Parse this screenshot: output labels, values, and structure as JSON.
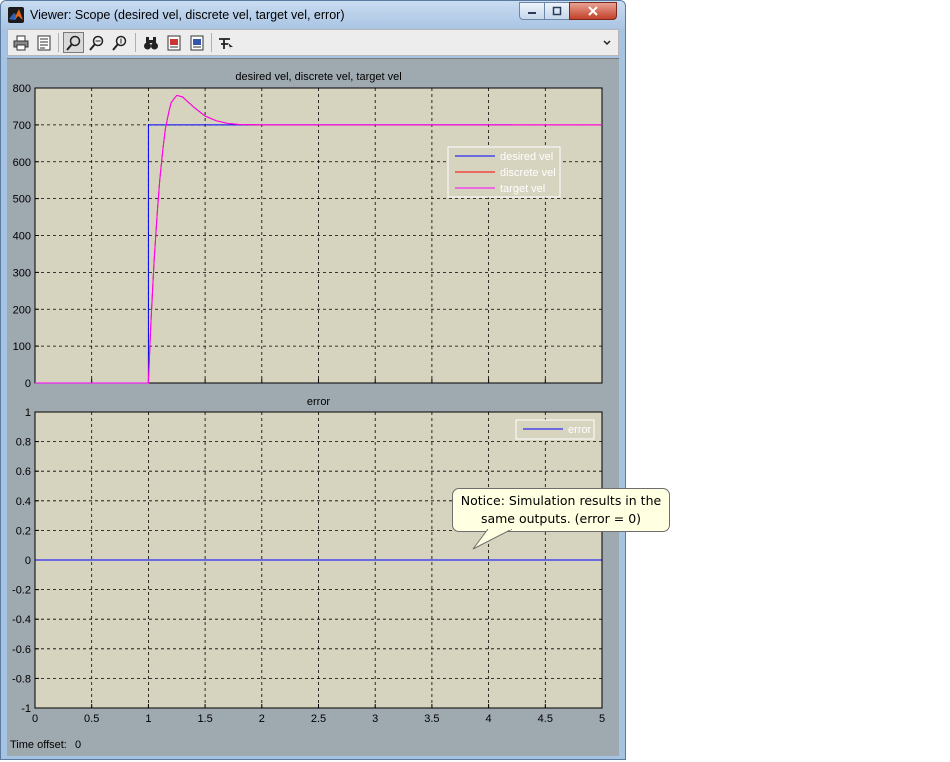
{
  "window": {
    "title": "Viewer: Scope (desired vel, discrete vel, target vel, error)",
    "footer_label": "Time offset:",
    "footer_value": "0"
  },
  "toolbar": {
    "icons": [
      "print-icon",
      "parameters-icon",
      "zoom-icon",
      "zoom-x-icon",
      "zoom-y-icon",
      "autoscale-icon",
      "save-axes-icon",
      "restore-axes-icon",
      "floating-scope-icon"
    ]
  },
  "callout": {
    "line1": "Notice: Simulation results in the",
    "line2": "same outputs. (error = 0)"
  },
  "colors": {
    "plot_background": "#d6d3bf",
    "figure_background": "#9fa9b0",
    "desired": "#0000ff",
    "discrete": "#ff0000",
    "target": "#ff00ff",
    "error": "#0000ff"
  },
  "chart_data": [
    {
      "type": "line",
      "title": "desired vel, discrete vel, target vel",
      "xlim": [
        0,
        5
      ],
      "ylim": [
        0,
        800
      ],
      "xticks": [
        0,
        0.5,
        1,
        1.5,
        2,
        2.5,
        3,
        3.5,
        4,
        4.5,
        5
      ],
      "yticks": [
        0,
        100,
        200,
        300,
        400,
        500,
        600,
        700,
        800
      ],
      "grid": true,
      "legend_position": "right",
      "series": [
        {
          "name": "desired vel",
          "color": "#0000ff",
          "x": [
            0,
            1,
            1,
            2.15,
            3.2,
            4.2
          ],
          "y": [
            0,
            0,
            700,
            700,
            700,
            700
          ]
        },
        {
          "name": "discrete vel",
          "color": "#ff0000",
          "x": [
            0,
            1,
            1.02,
            1.05,
            1.08,
            1.1,
            1.13,
            1.15,
            1.18,
            1.2,
            1.25,
            1.3,
            1.35,
            1.4,
            1.5,
            1.6,
            1.7,
            1.8,
            2.0,
            2.2,
            5
          ],
          "y": [
            0,
            0,
            150,
            330,
            470,
            550,
            640,
            690,
            735,
            760,
            780,
            776,
            762,
            748,
            724,
            711,
            704,
            701,
            700,
            700,
            700
          ]
        },
        {
          "name": "target vel",
          "color": "#ff00ff",
          "x": [
            0,
            1,
            1.02,
            1.05,
            1.08,
            1.1,
            1.13,
            1.15,
            1.18,
            1.2,
            1.25,
            1.3,
            1.35,
            1.4,
            1.5,
            1.6,
            1.7,
            1.8,
            2.0,
            2.2,
            5
          ],
          "y": [
            0,
            0,
            150,
            330,
            470,
            550,
            640,
            690,
            735,
            760,
            780,
            776,
            762,
            748,
            724,
            711,
            704,
            701,
            700,
            700,
            700
          ]
        }
      ]
    },
    {
      "type": "line",
      "title": "error",
      "xlim": [
        0,
        5
      ],
      "ylim": [
        -1,
        1
      ],
      "xticks": [
        0,
        0.5,
        1,
        1.5,
        2,
        2.5,
        3,
        3.5,
        4,
        4.5,
        5
      ],
      "yticks": [
        -1,
        -0.8,
        -0.6,
        -0.4,
        -0.2,
        0,
        0.2,
        0.4,
        0.6,
        0.8,
        1
      ],
      "grid": true,
      "legend_position": "top-right",
      "series": [
        {
          "name": "error",
          "color": "#0000ff",
          "x": [
            0,
            5
          ],
          "y": [
            0,
            0
          ]
        }
      ]
    }
  ]
}
